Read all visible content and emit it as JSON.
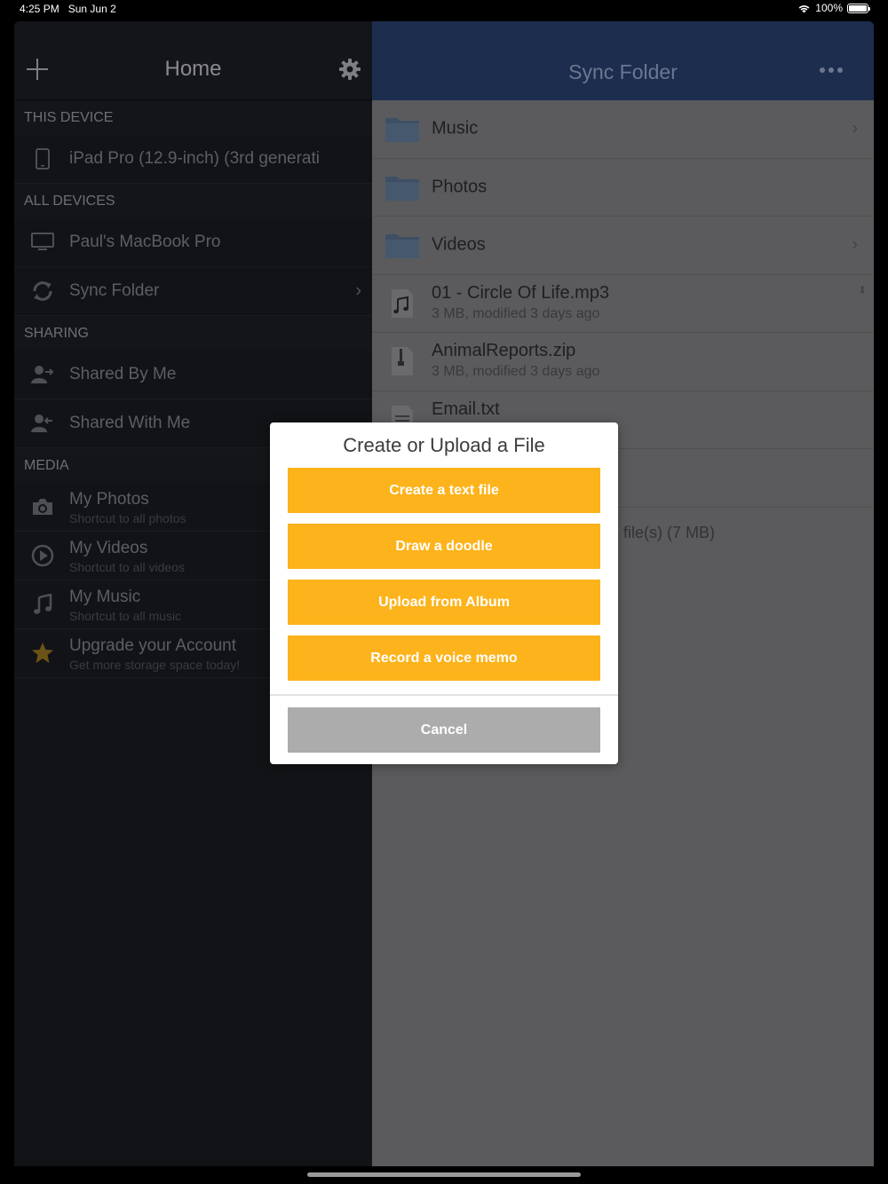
{
  "status": {
    "time": "4:25 PM",
    "date": "Sun Jun 2",
    "battery": "100%",
    "battery_level": 1.0
  },
  "left": {
    "title": "Home",
    "sections": {
      "this_device": "THIS DEVICE",
      "all_devices": "ALL DEVICES",
      "sharing": "SHARING",
      "media": "MEDIA"
    },
    "items": {
      "ipad": {
        "label": "iPad Pro (12.9-inch) (3rd generati",
        "icon": "tablet-icon"
      },
      "macbook": {
        "label": "Paul's MacBook Pro",
        "icon": "monitor-icon"
      },
      "sync_folder": {
        "label": "Sync Folder",
        "icon": "sync-icon"
      },
      "shared_by_me": {
        "label": "Shared By Me",
        "icon": "share-user-icon"
      },
      "shared_with_me": {
        "label": "Shared With Me",
        "icon": "share-user-icon"
      },
      "my_photos": {
        "label": "My Photos",
        "sub": "Shortcut to all photos",
        "icon": "camera-icon"
      },
      "my_videos": {
        "label": "My Videos",
        "sub": "Shortcut to all videos",
        "icon": "play-icon"
      },
      "my_music": {
        "label": "My Music",
        "sub": "Shortcut to all music",
        "icon": "music-note-icon"
      },
      "upgrade": {
        "label": "Upgrade your Account",
        "sub": "Get more storage space today!",
        "icon": "star-icon"
      }
    }
  },
  "right": {
    "title": "Sync Folder",
    "files": [
      {
        "name": "Music",
        "type": "folder"
      },
      {
        "name": "Photos",
        "type": "folder"
      },
      {
        "name": "Videos",
        "type": "folder"
      },
      {
        "name": "01 - Circle Of Life.mp3",
        "meta": "3 MB, modified 3 days ago",
        "type": "audio"
      },
      {
        "name": "AnimalReports.zip",
        "meta": "3 MB, modified 3 days ago",
        "type": "zip"
      },
      {
        "name": "Email.txt",
        "type": "text"
      }
    ],
    "summary": "file(s) (7 MB)"
  },
  "modal": {
    "title": "Create or Upload a File",
    "buttons": {
      "create_text": "Create a text file",
      "doodle": "Draw a doodle",
      "upload_album": "Upload from Album",
      "voice_memo": "Record a voice memo"
    },
    "cancel": "Cancel"
  },
  "colors": {
    "accent": "#fdb31b",
    "header_blue": "#1c2d4e",
    "cancel_gray": "#acacac"
  }
}
